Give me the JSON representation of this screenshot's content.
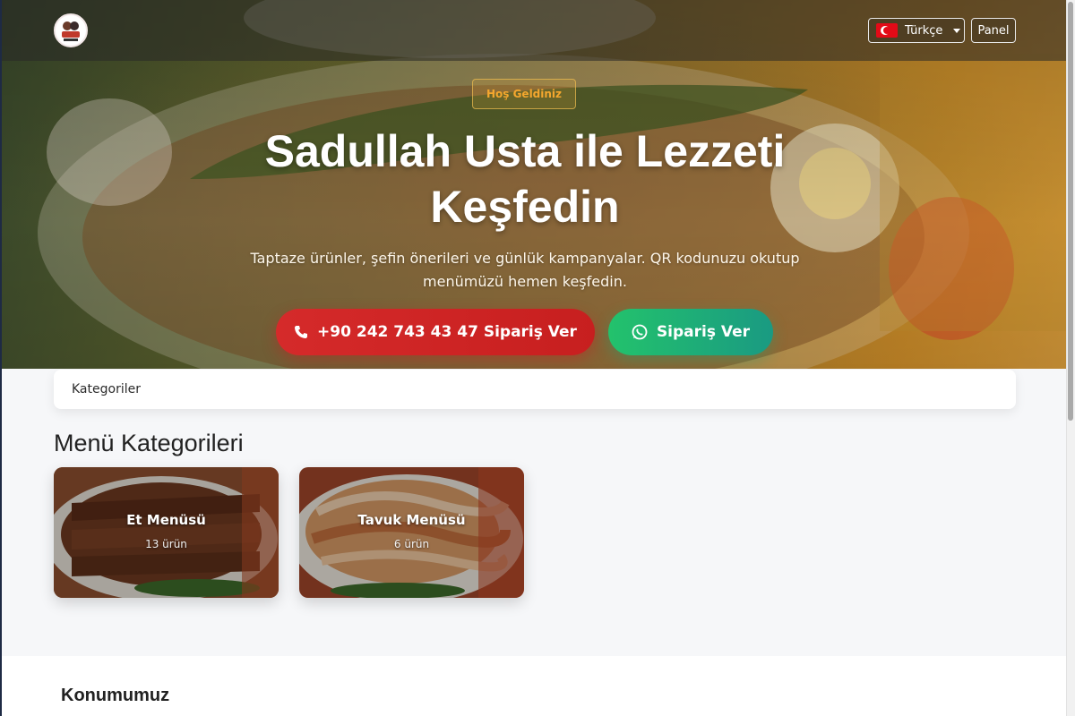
{
  "navbar": {
    "language": "Türkçe",
    "panel": "Panel"
  },
  "hero": {
    "badge": "Hoş Geldiniz",
    "title": "Sadullah Usta ile Lezzeti Keşfedin",
    "subtitle": "Taptaze ürünler, şefin önerileri ve günlük kampanyalar. QR kodunuzu okutup menümüzü hemen keşfedin.",
    "call_button": "+90 242 743 43 47 Sipariş Ver",
    "whatsapp_button": "Sipariş Ver"
  },
  "categories_bar": {
    "label": "Kategoriler"
  },
  "menu": {
    "title": "Menü Kategorileri",
    "cards": [
      {
        "title": "Et Menüsü",
        "count": "13 ürün"
      },
      {
        "title": "Tavuk Menüsü",
        "count": "6 ürün"
      }
    ]
  },
  "location": {
    "title": "Konumumuz"
  },
  "colors": {
    "call_button": "#d52a2a",
    "whatsapp_button": "#23c26c",
    "badge": "#f4a72e",
    "page_bg": "#f6f7f9"
  },
  "icons": [
    "logo",
    "flag-tr-icon",
    "chevron-down-icon",
    "phone-icon",
    "whatsapp-icon"
  ]
}
